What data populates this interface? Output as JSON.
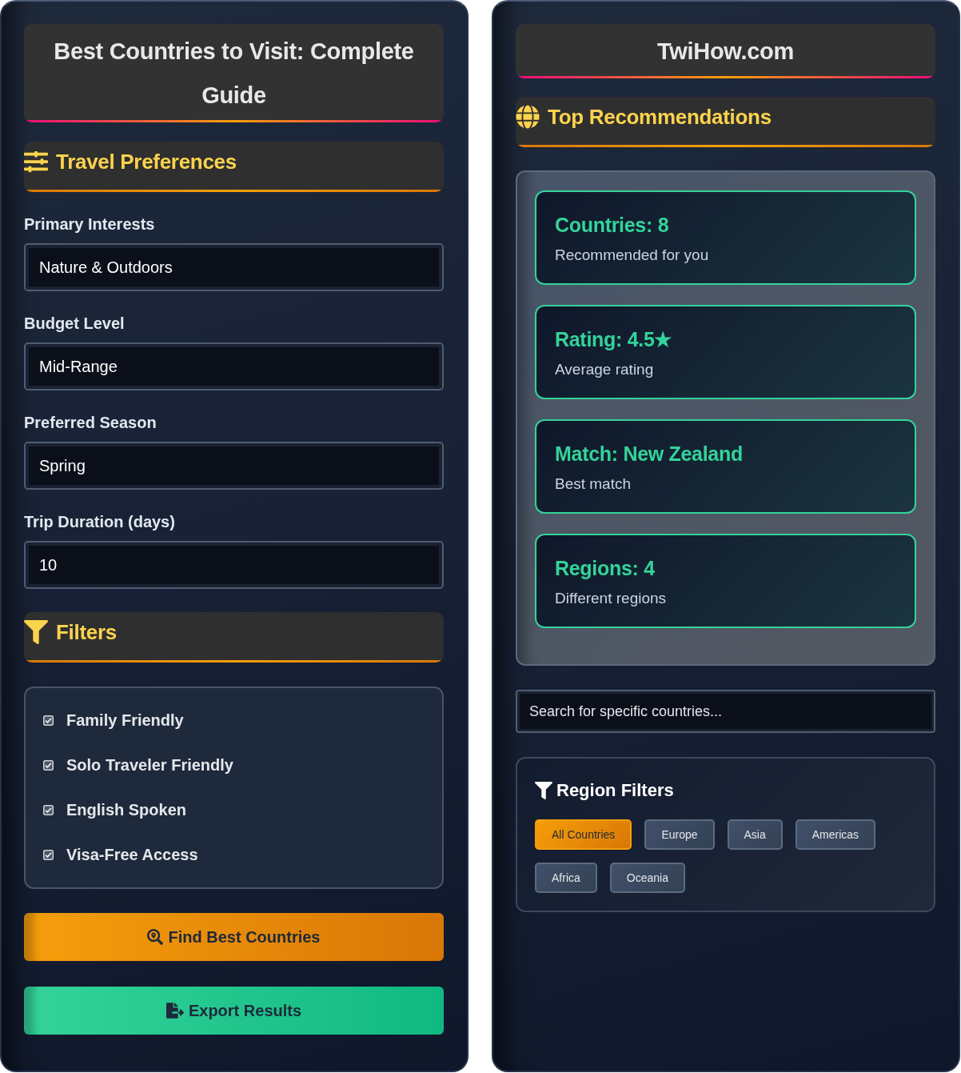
{
  "guide": {
    "title": "Best Countries to Visit: Complete Guide"
  },
  "preferences": {
    "heading": "Travel Preferences",
    "fields": [
      {
        "label": "Primary Interests",
        "value": "Nature & Outdoors"
      },
      {
        "label": "Budget Level",
        "value": "Mid-Range"
      },
      {
        "label": "Preferred Season",
        "value": "Spring"
      },
      {
        "label": "Trip Duration (days)",
        "value": "10"
      }
    ]
  },
  "filters": {
    "heading": "Filters",
    "options": [
      {
        "label": "Family Friendly",
        "checked": true
      },
      {
        "label": "Solo Traveler Friendly",
        "checked": true
      },
      {
        "label": "English Spoken",
        "checked": true
      },
      {
        "label": "Visa-Free Access",
        "checked": true
      }
    ]
  },
  "actions": [
    {
      "label": "Find Best Countries",
      "kind": "find"
    },
    {
      "label": "Export Results",
      "kind": "export"
    }
  ],
  "site": {
    "title": "TwiHow.com"
  },
  "recommendations": {
    "heading": "Top Recommendations",
    "stats": [
      {
        "title": "Countries: 8",
        "caption": "Recommended for you"
      },
      {
        "title": "Rating: 4.5★",
        "caption": "Average rating"
      },
      {
        "title": "Match: New Zealand",
        "caption": "Best match"
      },
      {
        "title": "Regions: 4",
        "caption": "Different regions"
      }
    ]
  },
  "search": {
    "placeholder": "Search for specific countries..."
  },
  "region_filters": {
    "heading": "Region Filters",
    "chips": [
      {
        "label": "All Countries",
        "selected": true
      },
      {
        "label": "Europe",
        "selected": false
      },
      {
        "label": "Asia",
        "selected": false
      },
      {
        "label": "Americas",
        "selected": false
      },
      {
        "label": "Africa",
        "selected": false
      },
      {
        "label": "Oceania",
        "selected": false
      }
    ]
  }
}
